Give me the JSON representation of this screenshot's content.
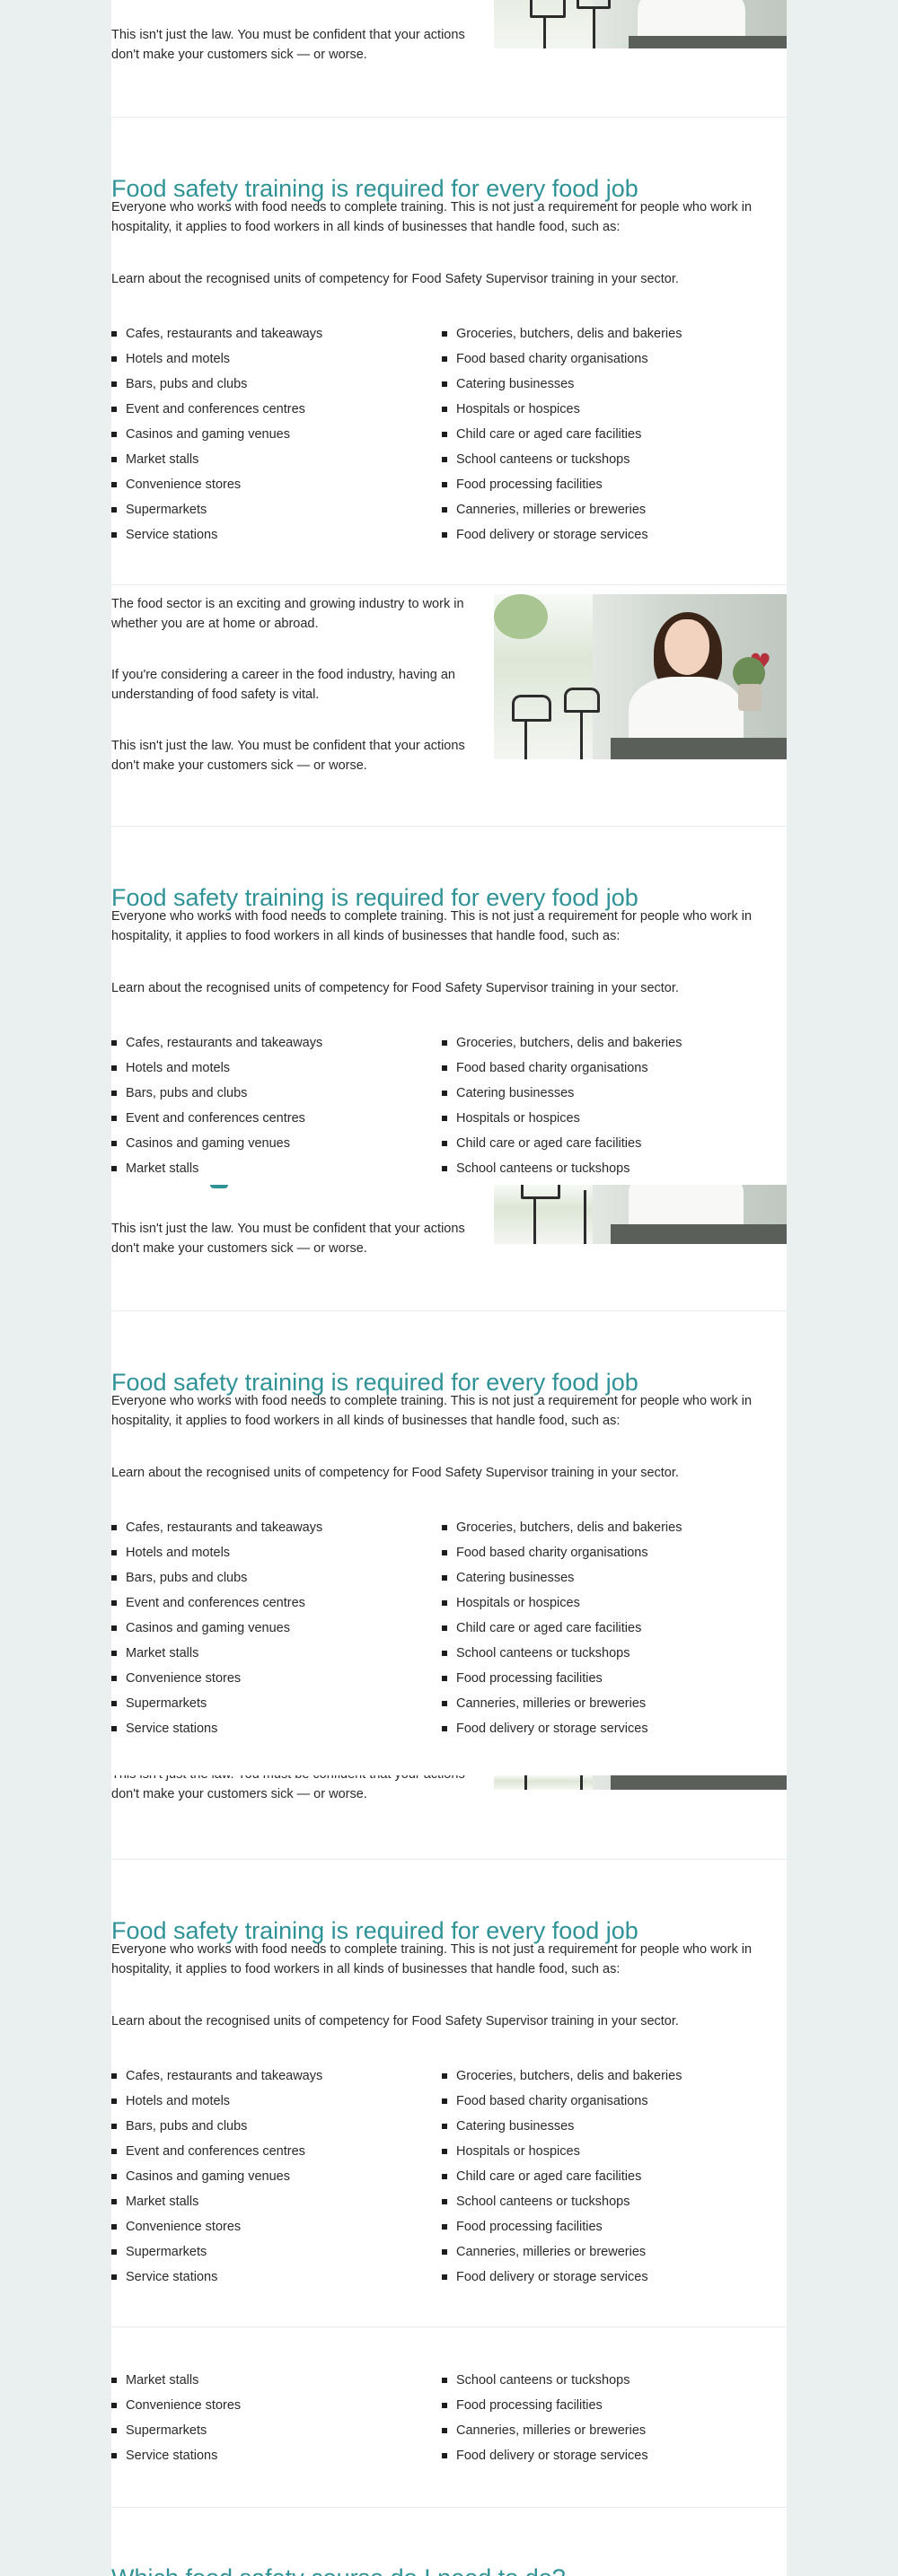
{
  "intro": {
    "p1": "The food sector is an exciting and growing industry to work in whether you are at home or abroad.",
    "p2": "If you're considering a career in the food industry, having an understanding of food safety is vital.",
    "p3": "This isn't just the law. You must be confident that your actions don't make your customers sick — or worse."
  },
  "training": {
    "heading": "Food safety training is required for every food job",
    "desc": "Everyone who works with food needs to complete training. This is not just a requirement for people who work in hospitality, it applies to food workers in all kinds of businesses that handle food, such as:",
    "learn": "Learn about the recognised units of competency for Food Safety Supervisor training in your sector.",
    "left_items": [
      "Cafes, restaurants and takeaways",
      "Hotels and motels",
      "Bars, pubs and clubs",
      "Event and conferences centres",
      "Casinos and gaming venues",
      "Market stalls",
      "Convenience stores",
      "Supermarkets",
      "Service stations"
    ],
    "right_items": [
      "Groceries, butchers, delis and bakeries",
      "Food based charity organisations",
      "Catering businesses",
      "Hospitals or hospices",
      "Child care or aged care facilities",
      "School canteens or tuckshops",
      "Food processing facilities",
      "Canneries, milleries or breweries",
      "Food delivery or storage services"
    ]
  },
  "next_heading": "Which food safety course do I need to do?",
  "photo": {
    "icon": "cafe-worker-photo"
  }
}
